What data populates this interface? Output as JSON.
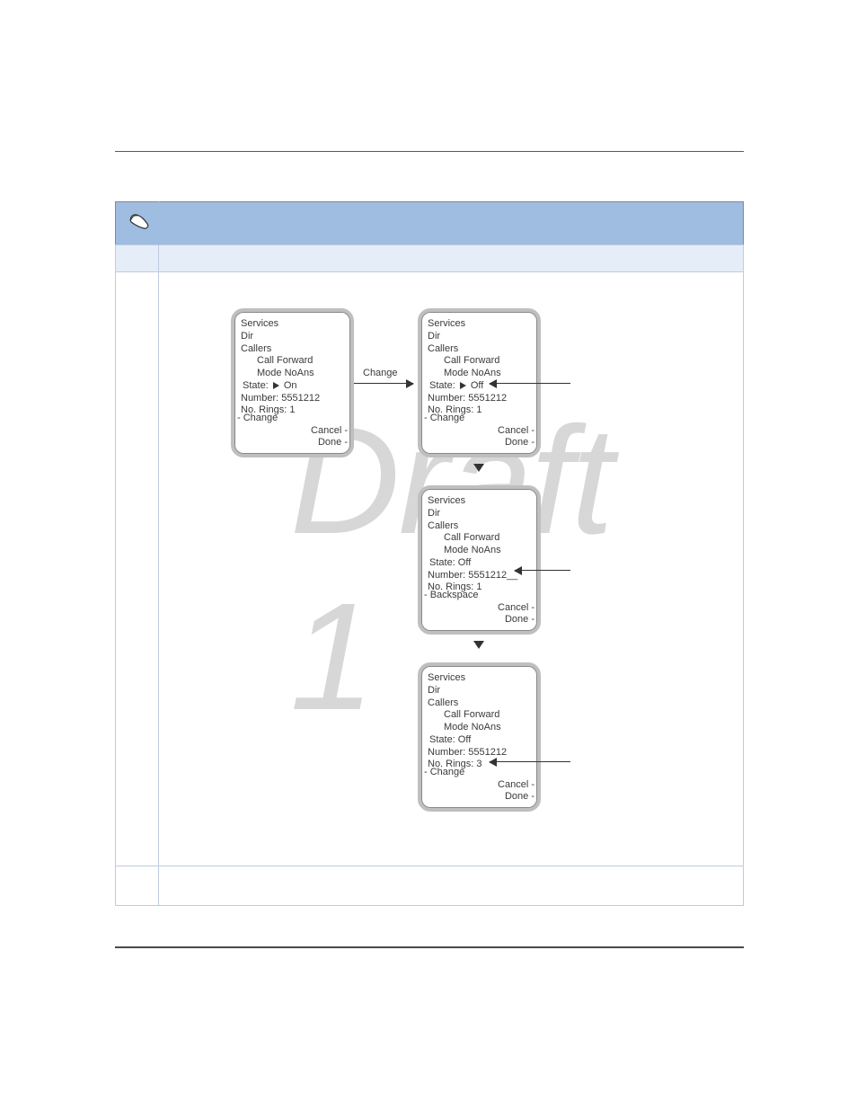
{
  "watermark": "Draft 1",
  "change_label": "Change",
  "down_icon": "▼",
  "panels": {
    "a": {
      "l1": "Services",
      "l2": "Dir",
      "l3": "Callers",
      "l4": "Call Forward",
      "l5": "Mode NoAns",
      "state_label": "State:",
      "state_val": "On",
      "num": "Number: 5551212",
      "rings": "No. Rings: 1",
      "bleft": "- Change",
      "br1": "Cancel -",
      "br2": "Done -"
    },
    "b": {
      "l1": "Services",
      "l2": "Dir",
      "l3": "Callers",
      "l4": "Call Forward",
      "l5": "Mode NoAns",
      "state_label": "State:",
      "state_val": "Off",
      "num": "Number: 5551212",
      "rings": "No. Rings: 1",
      "bleft": "- Change",
      "br1": "Cancel -",
      "br2": "Done -"
    },
    "c": {
      "l1": "Services",
      "l2": "Dir",
      "l3": "Callers",
      "l4": "Call Forward",
      "l5": "Mode NoAns",
      "state": "State:     Off",
      "num": "Number: 5551212__",
      "rings": "No. Rings: 1",
      "bleft": "- Backspace",
      "br1": "Cancel -",
      "br2": "Done -"
    },
    "d": {
      "l1": "Services",
      "l2": "Dir",
      "l3": "Callers",
      "l4": "Call Forward",
      "l5": "Mode NoAns",
      "state": "State:     Off",
      "num": "Number: 5551212",
      "rings": "No. Rings: 3",
      "bleft": "- Change",
      "br1": "Cancel -",
      "br2": "Done -"
    }
  }
}
